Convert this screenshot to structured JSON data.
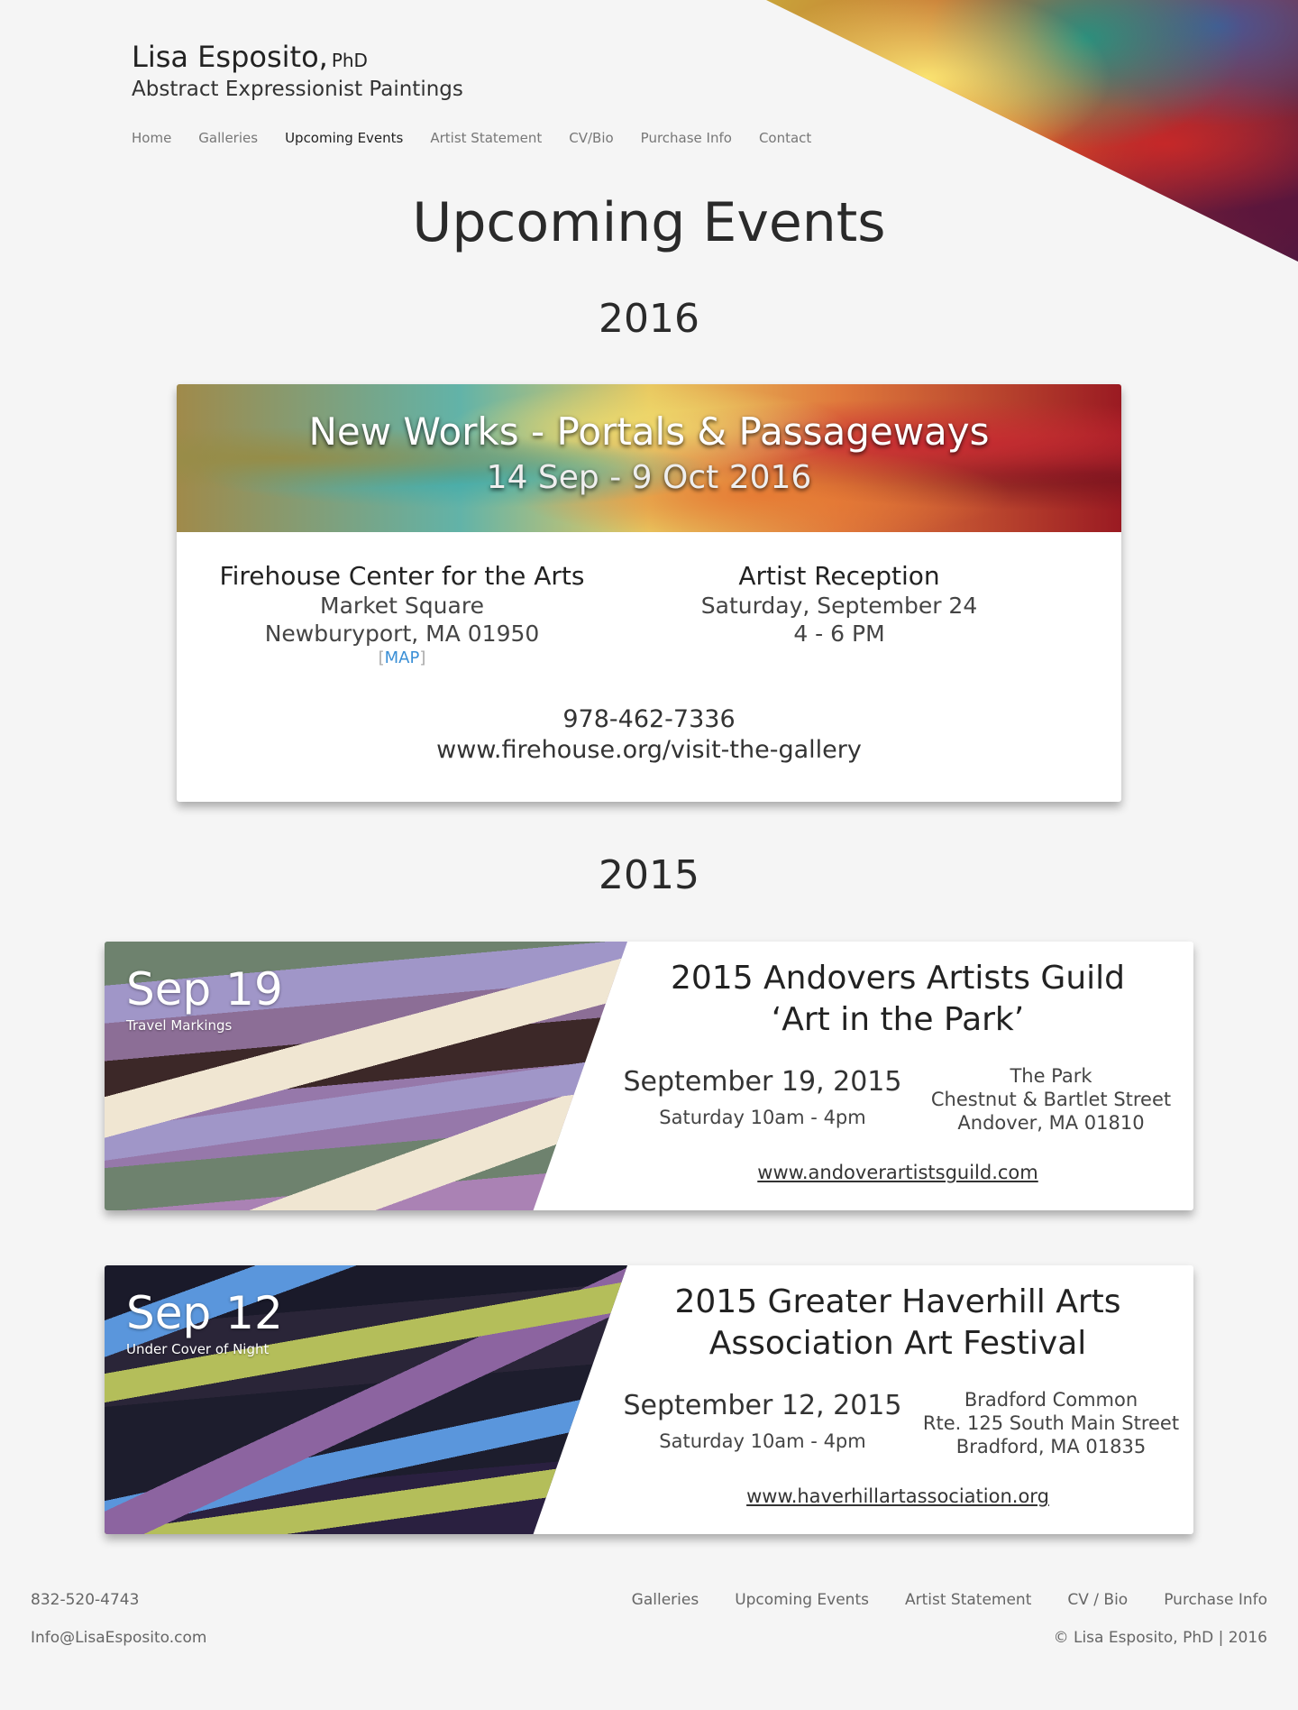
{
  "header": {
    "name": "Lisa Esposito,",
    "suffix": "PhD",
    "subtitle": "Abstract Expressionist Paintings"
  },
  "nav": [
    "Home",
    "Galleries",
    "Upcoming Events",
    "Artist Statement",
    "CV/Bio",
    "Purchase Info",
    "Contact"
  ],
  "nav_active": "Upcoming Events",
  "page_title": "Upcoming Events",
  "year_2016": "2016",
  "event_2016": {
    "title": "New Works - Portals & Passageways",
    "dates": "14 Sep - 9 Oct 2016",
    "venue": {
      "name": "Firehouse Center for the Arts",
      "line1": "Market Square",
      "line2": "Newburyport, MA 01950",
      "map_open": "[",
      "map_label": "MAP",
      "map_close": "]"
    },
    "reception": {
      "title": "Artist Reception",
      "date": "Saturday, September 24",
      "time": "4 - 6 PM"
    },
    "phone": "978-462-7336",
    "url": "www.firehouse.org/visit-the-gallery"
  },
  "year_2015": "2015",
  "events_2015": [
    {
      "date_short": "Sep 19",
      "painting": "Travel Markings",
      "title_line1": "2015 Andovers Artists Guild",
      "title_line2": "‘Art in the Park’",
      "date_long": "September 19, 2015",
      "time": "Saturday 10am - 4pm",
      "loc1": "The Park",
      "loc2": "Chestnut & Bartlet Street",
      "loc3": "Andover, MA 01810",
      "url": "www.andoverartistsguild.com"
    },
    {
      "date_short": "Sep 12",
      "painting": "Under Cover of Night",
      "title_line1": "2015 Greater Haverhill Arts",
      "title_line2": "Association Art Festival",
      "date_long": "September 12, 2015",
      "time": "Saturday 10am - 4pm",
      "loc1": "Bradford Common",
      "loc2": "Rte. 125 South Main Street",
      "loc3": "Bradford, MA 01835",
      "url": "www.haverhillartassociation.org"
    }
  ],
  "footer": {
    "phone": "832-520-4743",
    "email": "Info@LisaEsposito.com",
    "nav": [
      "Galleries",
      "Upcoming Events",
      "Artist Statement",
      "CV / Bio",
      "Purchase Info"
    ],
    "copyright": "© Lisa Esposito, PhD | 2016"
  },
  "colors": {
    "background": "#f5f5f5",
    "link": "#3a8fd6",
    "text": "#2a2a2a"
  }
}
